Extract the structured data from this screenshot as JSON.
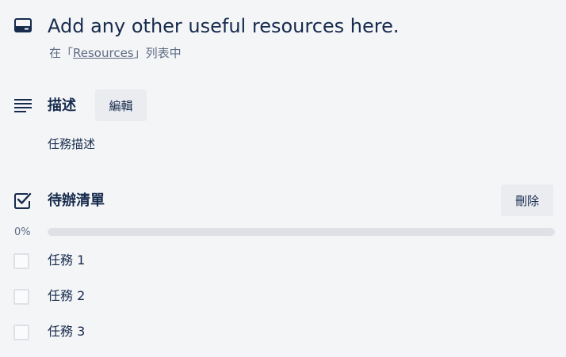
{
  "card": {
    "title": "Add any other useful resources here.",
    "list_prefix": "在「",
    "list_name": "Resources",
    "list_suffix": "」列表中"
  },
  "description": {
    "title": "描述",
    "edit_label": "編輯",
    "text": "任務描述"
  },
  "checklist": {
    "title": "待辦清單",
    "delete_label": "刪除",
    "progress_text": "0%",
    "progress": 0,
    "items": [
      {
        "label": "任務 1",
        "checked": false
      },
      {
        "label": "任務 2",
        "checked": false
      },
      {
        "label": "任務 3",
        "checked": false
      }
    ]
  },
  "colors": {
    "text": "#172b4d",
    "muted": "#5e6c84",
    "button_bg": "#eaecf0",
    "progress_track": "#dfe1e6",
    "progress_fill": "#5aac44"
  },
  "icons": {
    "card": "card-icon",
    "description": "description-icon",
    "checklist": "checklist-icon",
    "checkbox": "checkbox-icon"
  }
}
